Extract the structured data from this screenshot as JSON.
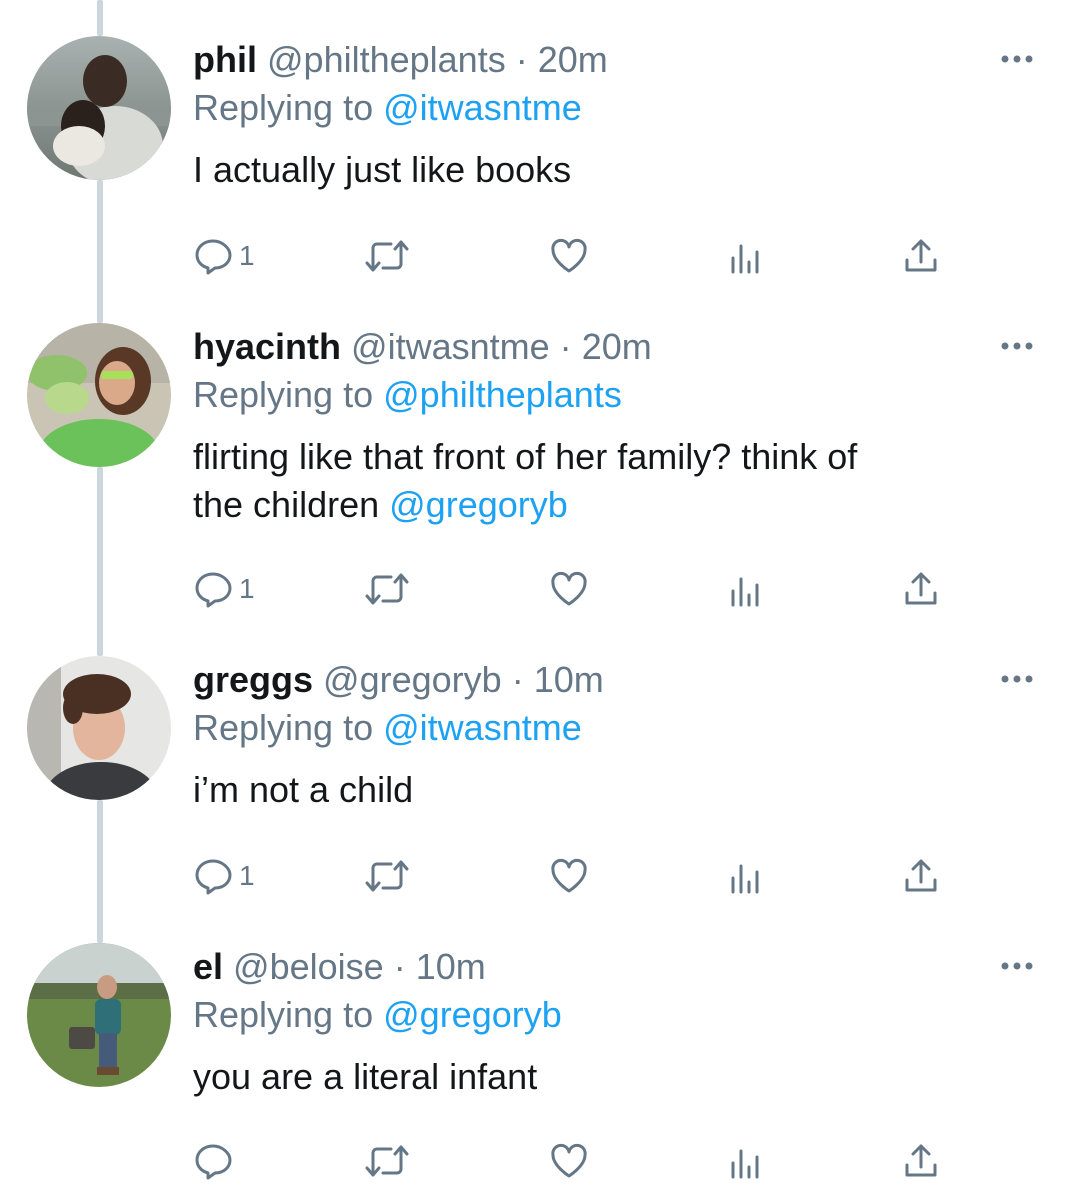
{
  "tweets": [
    {
      "name": "phil",
      "handle": "@philtheplants",
      "dot": "·",
      "time": "20m",
      "replying_prefix": "Replying to",
      "replying_to": "@itwasntme",
      "text_lines": [
        "I actually just like books"
      ],
      "text_mention": "",
      "reply_count": "1"
    },
    {
      "name": "hyacinth",
      "handle": "@itwasntme",
      "dot": "·",
      "time": "20m",
      "replying_prefix": "Replying to",
      "replying_to": "@philtheplants",
      "text_lines": [
        "flirting like that front of her family? think of",
        "the children"
      ],
      "text_mention": "@gregoryb",
      "reply_count": "1"
    },
    {
      "name": "greggs",
      "handle": "@gregoryb",
      "dot": "·",
      "time": "10m",
      "replying_prefix": "Replying to",
      "replying_to": "@itwasntme",
      "text_lines": [
        "i’m not a child"
      ],
      "text_mention": "",
      "reply_count": "1"
    },
    {
      "name": "el",
      "handle": "@beloise",
      "dot": "·",
      "time": "10m",
      "replying_prefix": "Replying to",
      "replying_to": "@gregoryb",
      "text_lines": [
        "you are a literal infant"
      ],
      "text_mention": "",
      "reply_count": ""
    }
  ],
  "icons": {
    "reply": "reply-icon",
    "retweet": "retweet-icon",
    "like": "heart-icon",
    "analytics": "analytics-icon",
    "share": "share-icon",
    "more": "more-icon"
  },
  "colors": {
    "link": "#1da1f2",
    "secondary": "#657786",
    "text": "#14171a",
    "thread_line": "#ccd6dd"
  }
}
